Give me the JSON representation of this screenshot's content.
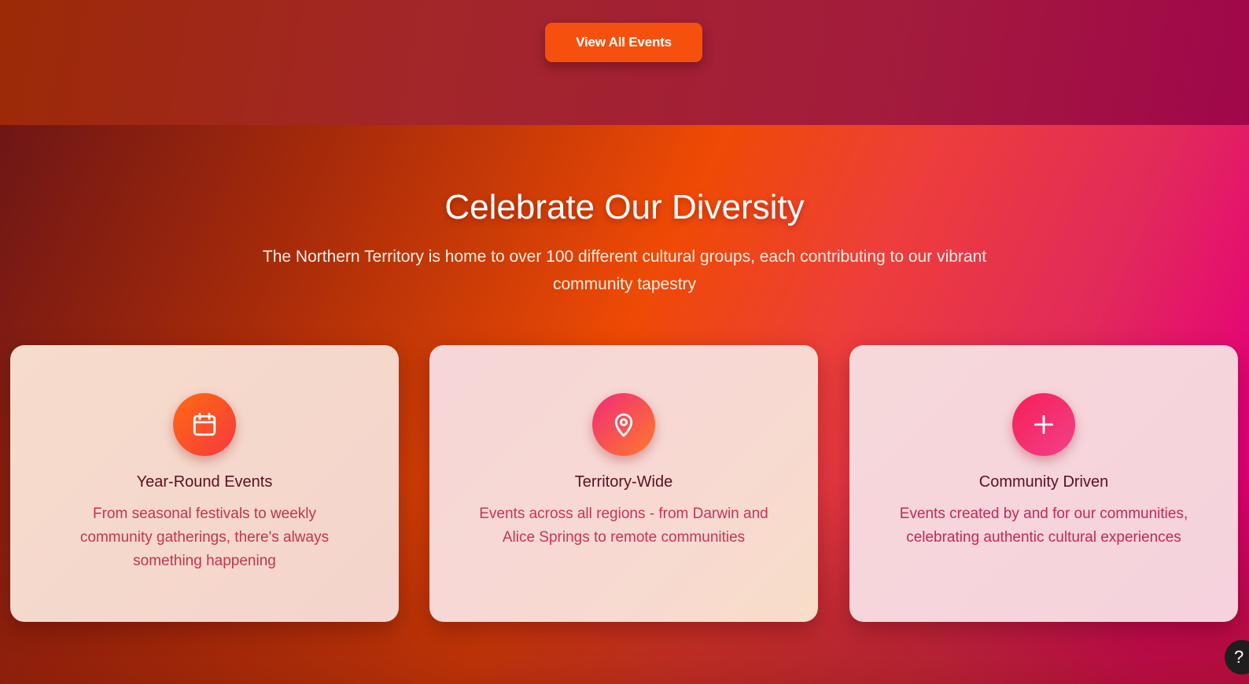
{
  "top_band": {
    "view_all_button": "View All Events"
  },
  "diversity": {
    "title": "Celebrate Our Diversity",
    "subtitle": "The Northern Territory is home to over 100 different cultural groups, each contributing to our vibrant community tapestry"
  },
  "cards": [
    {
      "icon": "calendar-icon",
      "title": "Year-Round Events",
      "description": "From seasonal festivals to weekly community gatherings, there's always something happening"
    },
    {
      "icon": "map-pin-icon",
      "title": "Territory-Wide",
      "description": "Events across all regions - from Darwin and Alice Springs to remote communities"
    },
    {
      "icon": "plus-icon",
      "title": "Community Driven",
      "description": "Events created by and for our communities, celebrating authentic cultural experiences"
    }
  ],
  "help": {
    "label": "?"
  },
  "colors": {
    "button": "#f5500e",
    "title_text": "#ffffff",
    "card_title": "#5a1020",
    "card_desc": "#c2364a"
  }
}
